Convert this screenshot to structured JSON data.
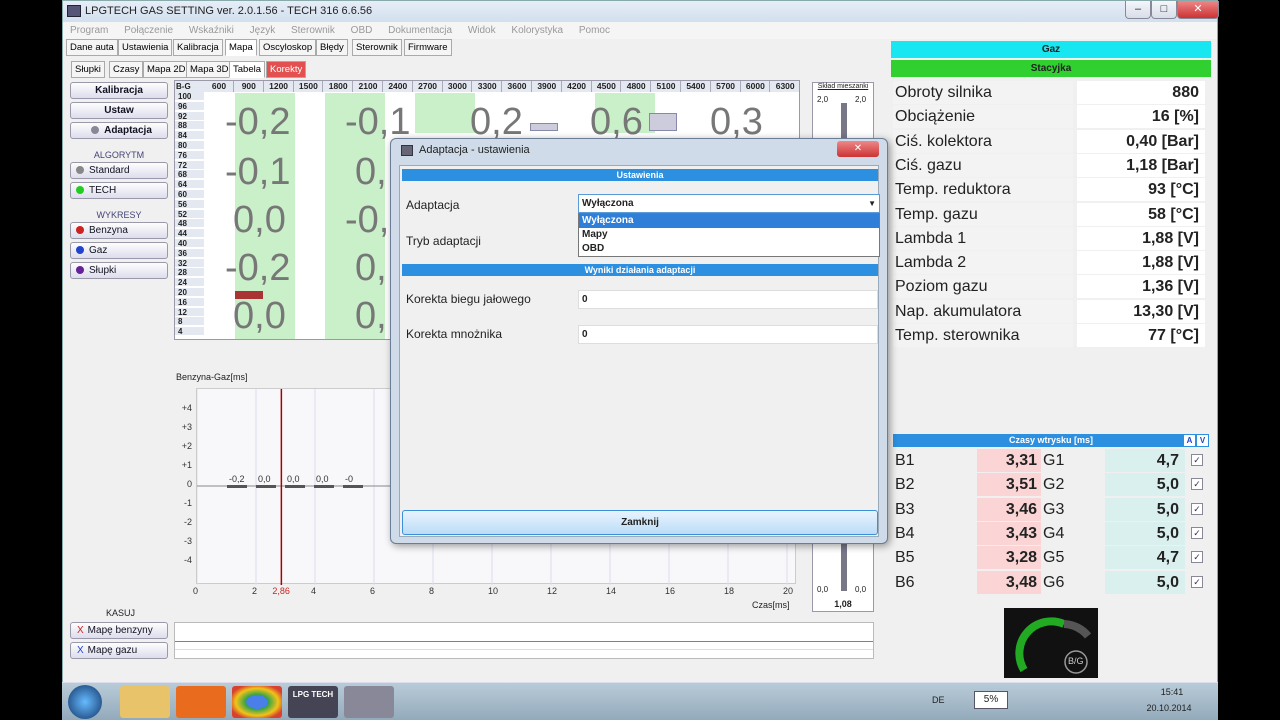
{
  "window": {
    "title": "LPGTECH GAS SETTING ver. 2.0.1.56  -  TECH 316   6.6.56"
  },
  "menu": [
    "Program",
    "Połączenie",
    "Wskaźniki",
    "Język",
    "Sterownik",
    "OBD",
    "Dokumentacja",
    "Widok",
    "Kolorystyka",
    "Pomoc"
  ],
  "tabs_main": [
    "Dane auta",
    "Ustawienia",
    "Kalibracja",
    "Mapa",
    "Oscyloskop",
    "Błędy",
    "Sterownik",
    "Firmware"
  ],
  "tabs_sub": [
    "Słupki",
    "Czasy",
    "Mapa 2D",
    "Mapa 3D",
    "Tabela",
    "Korekty"
  ],
  "sidebar": {
    "kalibracja": "Kalibracja",
    "ustaw": "Ustaw",
    "adaptacja": "Adaptacja",
    "algorytm_label": "ALGORYTM",
    "standard": "Standard",
    "tech": "TECH",
    "wykresy_label": "WYKRESY",
    "benzyna": "Benzyna",
    "gaz": "Gaz",
    "slupki": "Słupki",
    "kasuj_label": "KASUJ",
    "mape_benzyny": "Mapę benzyny",
    "mape_gazu": "Mapę gazu"
  },
  "grid": {
    "corner": "B-G",
    "rpm": [
      "600",
      "900",
      "1200",
      "1500",
      "1800",
      "2100",
      "2400",
      "2700",
      "3000",
      "3300",
      "3600",
      "3900",
      "4200",
      "4500",
      "4800",
      "5100",
      "5400",
      "5700",
      "6000",
      "6300"
    ],
    "rows": [
      "100",
      "96",
      "92",
      "88",
      "84",
      "80",
      "76",
      "72",
      "68",
      "64",
      "60",
      "56",
      "52",
      "48",
      "44",
      "40",
      "36",
      "32",
      "28",
      "24",
      "20",
      "16",
      "12",
      "8",
      "4"
    ],
    "values": [
      {
        "text": "-0,2"
      },
      {
        "text": "-0,1"
      },
      {
        "text": "0,2"
      },
      {
        "text": "0,6"
      },
      {
        "text": "0,3"
      },
      {
        "text": "-0,1"
      },
      {
        "text": "0,"
      },
      {
        "text": "0,0"
      },
      {
        "text": "-0,"
      },
      {
        "text": "-0,2"
      },
      {
        "text": "0,"
      },
      {
        "text": "0,0"
      },
      {
        "text": "0,"
      }
    ]
  },
  "mixture": {
    "label": "Skład mieszanki",
    "v1": "2,0",
    "v2": "2,0",
    "value": "1,08",
    "v3": "0,0"
  },
  "chart": {
    "title": "Benzyna-Gaz[ms]",
    "yticks": [
      "+4",
      "+3",
      "+2",
      "+1",
      "0",
      "-1",
      "-2",
      "-3",
      "-4"
    ],
    "xticks": [
      "0",
      "2",
      "4",
      "6",
      "8",
      "10",
      "12",
      "14",
      "16",
      "18",
      "20"
    ],
    "marker": "2,86",
    "xlabel": "Czas[ms]",
    "labels": [
      "-0,2",
      "0,0",
      "0,0",
      "0,0",
      "-0"
    ]
  },
  "right": {
    "gaz": "Gaz",
    "stacyjka": "Stacyjka",
    "params": [
      {
        "label": "Obroty silnika",
        "value": "880"
      },
      {
        "label": "Obciążenie",
        "value": "16 [%]"
      },
      {
        "label": "Ciś. kolektora",
        "value": "0,40 [Bar]"
      },
      {
        "label": "Ciś. gazu",
        "value": "1,18 [Bar]"
      },
      {
        "label": "Temp. reduktora",
        "value": "93 [°C]"
      },
      {
        "label": "Temp. gazu",
        "value": "58 [°C]"
      },
      {
        "label": "Lambda 1",
        "value": "1,88 [V]"
      },
      {
        "label": "Lambda 2",
        "value": "1,88 [V]"
      },
      {
        "label": "Poziom gazu",
        "value": "1,36 [V]"
      },
      {
        "label": "Nap. akumulatora",
        "value": "13,30 [V]"
      },
      {
        "label": "Temp. sterownika",
        "value": "77 [°C]"
      }
    ],
    "inj_title": "Czasy wtrysku [ms]",
    "inj_btn_a": "A",
    "inj_btn_v": "V",
    "injectors": [
      {
        "b": "B1",
        "bv": "3,31",
        "g": "G1",
        "gv": "4,7"
      },
      {
        "b": "B2",
        "bv": "3,51",
        "g": "G2",
        "gv": "5,0"
      },
      {
        "b": "B3",
        "bv": "3,46",
        "g": "G3",
        "gv": "5,0"
      },
      {
        "b": "B4",
        "bv": "3,43",
        "g": "G4",
        "gv": "5,0"
      },
      {
        "b": "B5",
        "bv": "3,28",
        "g": "G5",
        "gv": "4,7"
      },
      {
        "b": "B6",
        "bv": "3,48",
        "g": "G6",
        "gv": "5,0"
      }
    ],
    "bg_label": "B/G"
  },
  "dialog": {
    "title": "Adaptacja - ustawienia",
    "section1": "Ustawienia",
    "adaptacja_label": "Adaptacja",
    "adaptacja_value": "Wyłączona",
    "options": [
      "Wyłączona",
      "Mapy",
      "OBD"
    ],
    "tryb_label": "Tryb adaptacji",
    "section2": "Wyniki działania adaptacji",
    "korekta_biegu_label": "Korekta biegu jałowego",
    "korekta_biegu_value": "0",
    "korekta_mnoznika_label": "Korekta mnożnika",
    "korekta_mnoznika_value": "0",
    "close": "Zamknij"
  },
  "taskbar": {
    "lang": "DE",
    "battery": "5%",
    "time": "15:41",
    "date": "20.10.2014",
    "lpg_label": "LPG TECH"
  }
}
